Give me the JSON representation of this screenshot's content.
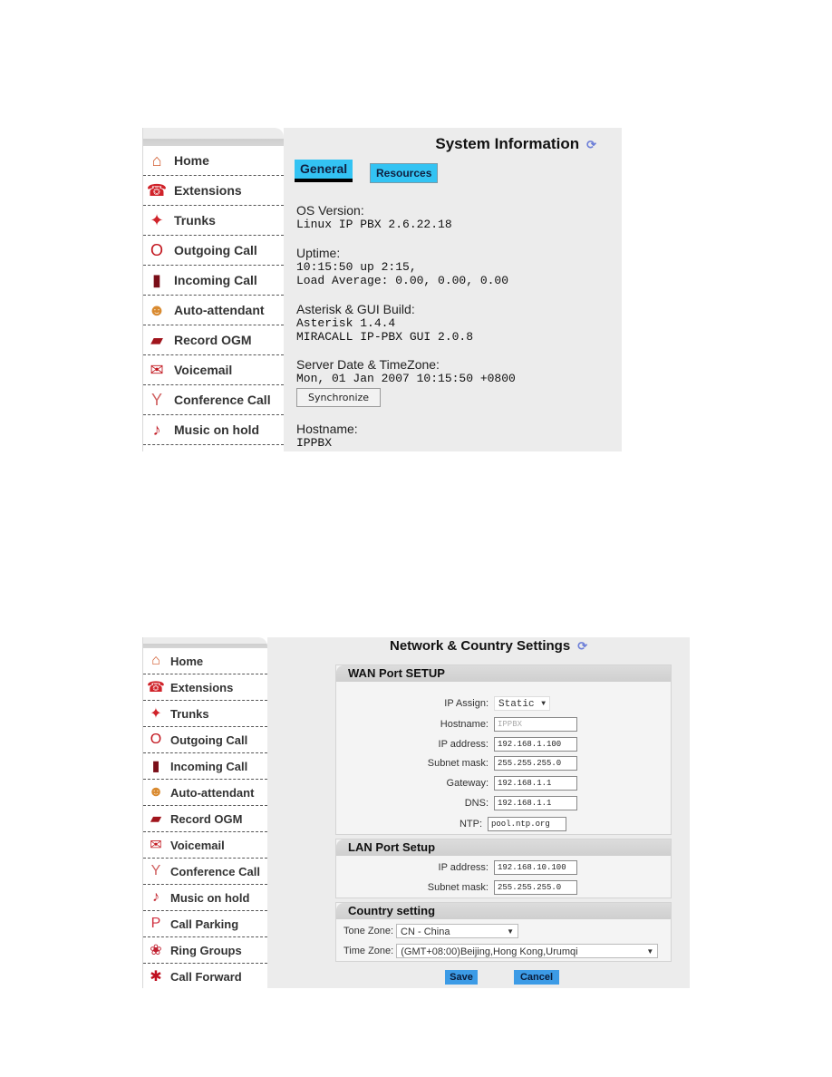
{
  "sidebar_items": [
    {
      "label": "Home",
      "icon": "home-icon",
      "glyph": "⌂",
      "color": "#d0572a"
    },
    {
      "label": "Extensions",
      "icon": "extensions-phone-icon",
      "glyph": "☎",
      "color": "#d0232a"
    },
    {
      "label": "Trunks",
      "icon": "trunks-icon",
      "glyph": "✦",
      "color": "#d0232a"
    },
    {
      "label": "Outgoing Call",
      "icon": "outgoing-call-icon",
      "glyph": "O",
      "color": "#c2161e"
    },
    {
      "label": "Incoming Call",
      "icon": "incoming-call-icon",
      "glyph": "▮",
      "color": "#7a0e18"
    },
    {
      "label": "Auto-attendant",
      "icon": "auto-attendant-users-icon",
      "glyph": "☻",
      "color": "#d98a30"
    },
    {
      "label": "Record OGM",
      "icon": "record-ogm-book-icon",
      "glyph": "▰",
      "color": "#a0141c"
    },
    {
      "label": "Voicemail",
      "icon": "voicemail-icon",
      "glyph": "✉",
      "color": "#c21a22"
    },
    {
      "label": "Conference Call",
      "icon": "conference-call-icon",
      "glyph": "Y",
      "color": "#d06060"
    },
    {
      "label": "Music on hold",
      "icon": "music-on-hold-icon",
      "glyph": "♪",
      "color": "#c2202a"
    },
    {
      "label": "Call Parking",
      "icon": "call-parking-icon",
      "glyph": "P",
      "color": "#d03040"
    },
    {
      "label": "Ring Groups",
      "icon": "ring-groups-icon",
      "glyph": "❀",
      "color": "#c02030"
    },
    {
      "label": "Call Forward",
      "icon": "call-forward-icon",
      "glyph": "✱",
      "color": "#c01020"
    }
  ],
  "system_info": {
    "title": "System Information",
    "tabs": [
      "General",
      "Resources"
    ],
    "os_label": "OS Version:",
    "os_value": "Linux IP PBX 2.6.22.18",
    "uptime_label": "Uptime:",
    "uptime_value1": "10:15:50 up 2:15,",
    "uptime_value2": "Load Average: 0.00, 0.00, 0.00",
    "build_label": "Asterisk & GUI Build:",
    "build_value1": "Asterisk 1.4.4",
    "build_value2": "MIRACALL IP-PBX GUI 2.0.8",
    "date_label": "Server Date & TimeZone:",
    "date_value": "Mon, 01 Jan 2007 10:15:50 +0800",
    "sync_button": "Synchronize",
    "hostname_label": "Hostname:",
    "hostname_value": "IPPBX"
  },
  "network": {
    "title": "Network & Country Settings",
    "wan": {
      "header": "WAN Port SETUP",
      "ip_assign_label": "IP Assign:",
      "ip_assign_value": "Static",
      "hostname_label": "Hostname:",
      "hostname_value": "IPPBX",
      "ip_label": "IP address:",
      "ip_value": "192.168.1.100",
      "mask_label": "Subnet mask:",
      "mask_value": "255.255.255.0",
      "gateway_label": "Gateway:",
      "gateway_value": "192.168.1.1",
      "dns_label": "DNS:",
      "dns_value": "192.168.1.1",
      "ntp_label": "NTP:",
      "ntp_value": "pool.ntp.org"
    },
    "lan": {
      "header": "LAN Port Setup",
      "ip_label": "IP address:",
      "ip_value": "192.168.10.100",
      "mask_label": "Subnet mask:",
      "mask_value": "255.255.255.0"
    },
    "country": {
      "header": "Country setting",
      "tone_label": "Tone Zone:",
      "tone_value": "CN - China",
      "time_label": "Time Zone:",
      "time_value": "(GMT+08:00)Beijing,Hong Kong,Urumqi"
    },
    "save": "Save",
    "cancel": "Cancel"
  }
}
